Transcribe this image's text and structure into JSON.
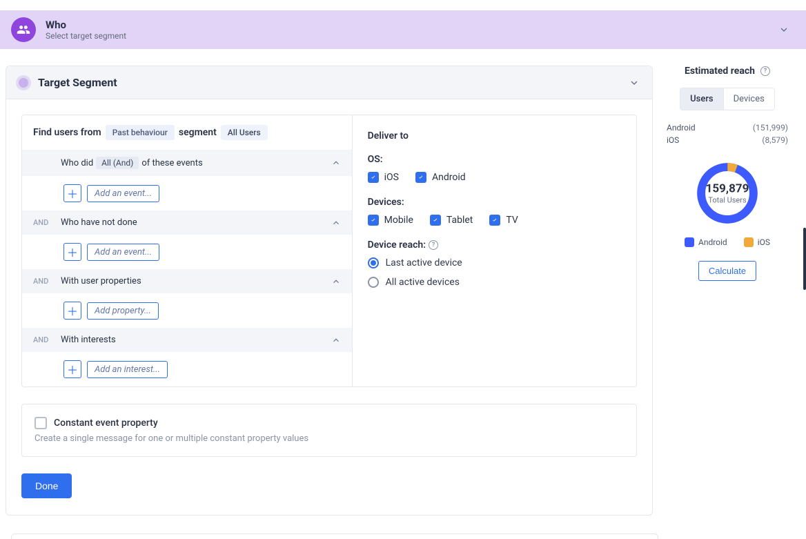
{
  "banner": {
    "title": "Who",
    "subtitle": "Select target segment"
  },
  "segment": {
    "title": "Target Segment",
    "find": {
      "prefix": "Find users from",
      "behaviour_pill": "Past behaviour",
      "middle": "segment",
      "users_pill": "All Users"
    },
    "clause1": {
      "prefix": "Who did",
      "match_pill": "All (And)",
      "suffix": "of these events",
      "add_label": "Add an event..."
    },
    "clause2": {
      "and": "AND",
      "label": "Who have not done",
      "add_label": "Add an event..."
    },
    "clause3": {
      "and": "AND",
      "label": "With user properties",
      "add_label": "Add property..."
    },
    "clause4": {
      "and": "AND",
      "label": "With interests",
      "add_label": "Add an interest..."
    }
  },
  "deliver": {
    "title": "Deliver to",
    "os_label": "OS:",
    "os": {
      "ios": "iOS",
      "android": "Android"
    },
    "devices_label": "Devices:",
    "devices": {
      "mobile": "Mobile",
      "tablet": "Tablet",
      "tv": "TV"
    },
    "reach_label": "Device reach:",
    "radio_last": "Last active device",
    "radio_all": "All active devices"
  },
  "constant": {
    "label": "Constant event property",
    "sub": "Create a single message for one or multiple constant property values"
  },
  "done_label": "Done",
  "reach": {
    "title": "Estimated reach",
    "tab_users": "Users",
    "tab_devices": "Devices",
    "rows": {
      "android_label": "Android",
      "android_count": "(151,999)",
      "ios_label": "iOS",
      "ios_count": "(8,579)"
    },
    "total": "159,879",
    "total_label": "Total Users",
    "legend_android": "Android",
    "legend_ios": "iOS",
    "calculate": "Calculate"
  },
  "colors": {
    "android": "#3d5afe",
    "ios": "#f2a93b"
  },
  "chart_data": {
    "type": "pie",
    "title": "Estimated reach",
    "series": [
      {
        "name": "Android",
        "value": 151999,
        "color": "#3d5afe"
      },
      {
        "name": "iOS",
        "value": 8579,
        "color": "#f2a93b"
      }
    ],
    "total": 159879,
    "total_label": "Total Users"
  }
}
